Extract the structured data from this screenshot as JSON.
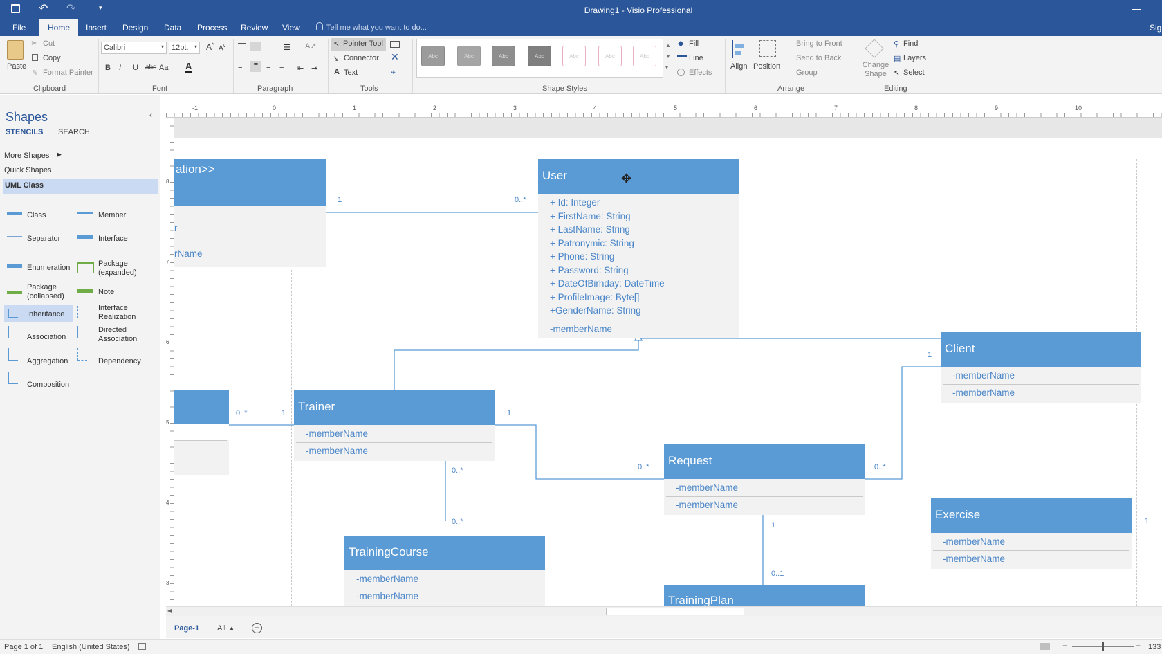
{
  "title": "Drawing1 - Visio Professional",
  "signin": "Sign",
  "tabs": [
    "File",
    "Home",
    "Insert",
    "Design",
    "Data",
    "Process",
    "Review",
    "View"
  ],
  "tell_me": "Tell me what you want to do...",
  "ribbon": {
    "paste": "Paste",
    "cut": "Cut",
    "copy": "Copy",
    "format_painter": "Format Painter",
    "font_name": "Calibri",
    "font_size": "12pt.",
    "bold": "B",
    "italic": "I",
    "underline": "U",
    "strike": "abc",
    "case": "Aa",
    "pointer_tool": "Pointer Tool",
    "connector": "Connector",
    "text": "Text",
    "swatch": "Abc",
    "fill": "Fill",
    "line": "Line",
    "effects": "Effects",
    "align": "Align",
    "position": "Position",
    "bring_front": "Bring to Front",
    "send_back": "Send to Back",
    "group": "Group",
    "change_shape": "Change Shape",
    "find": "Find",
    "layers": "Layers",
    "select": "Select",
    "groups": {
      "clipboard": "Clipboard",
      "font": "Font",
      "paragraph": "Paragraph",
      "tools": "Tools",
      "shape_styles": "Shape Styles",
      "arrange": "Arrange",
      "editing": "Editing"
    }
  },
  "shapes_panel": {
    "title": "Shapes",
    "stencils": "STENCILS",
    "search": "SEARCH",
    "more_shapes": "More Shapes",
    "quick_shapes": "Quick Shapes",
    "uml_class": "UML Class",
    "items": [
      "Class",
      "Member",
      "Separator",
      "Interface",
      "Enumeration",
      "Package (expanded)",
      "Package (collapsed)",
      "Note",
      "Inheritance",
      "Interface Realization",
      "Association",
      "Directed Association",
      "Aggregation",
      "Dependency",
      "Composition"
    ]
  },
  "ruler": {
    "h_ticks": [
      "-1",
      "0",
      "1",
      "2",
      "3",
      "4",
      "5",
      "6",
      "7",
      "8",
      "9",
      "10"
    ],
    "v_ticks": [
      "8",
      "7",
      "6",
      "5",
      "4",
      "3"
    ]
  },
  "diagram": {
    "left_top": {
      "head": "ation>>",
      "m1": "r",
      "m2": "rName"
    },
    "user": {
      "head": "User",
      "members": [
        "+ Id: Integer",
        "+ FirstName: String",
        "+ LastName: String",
        "+ Patronymic: String",
        "+ Phone: String",
        "+ Password: String",
        "+ DateOfBirhday: DateTime",
        "+ ProfileImage: Byte[]",
        "+GenderName: String"
      ],
      "extra": "-memberName"
    },
    "trainer": {
      "head": "Trainer",
      "members": [
        "-memberName",
        "-memberName"
      ]
    },
    "client": {
      "head": "Client",
      "members": [
        "-memberName",
        "-memberName"
      ]
    },
    "request": {
      "head": "Request",
      "members": [
        "-memberName",
        "-memberName"
      ]
    },
    "exercise": {
      "head": "Exercise",
      "members": [
        "-memberName",
        "-memberName"
      ]
    },
    "course": {
      "head": "TrainingCourse",
      "members": [
        "-memberName",
        "-memberName"
      ]
    },
    "plan": {
      "head": "TrainingPlan"
    },
    "mult": {
      "a": "1",
      "b": "0..*",
      "c": "0..*",
      "d": "1",
      "e": "1",
      "f": "0..*",
      "g": "0..*",
      "h": "0..*",
      "i": "1",
      "j": "0..*",
      "k": "1",
      "l": "0..1",
      "m": "1"
    }
  },
  "bottom": {
    "page": "Page-1",
    "all": "All"
  },
  "status": {
    "page": "Page 1 of 1",
    "lang": "English (United States)",
    "zoom": "133"
  }
}
